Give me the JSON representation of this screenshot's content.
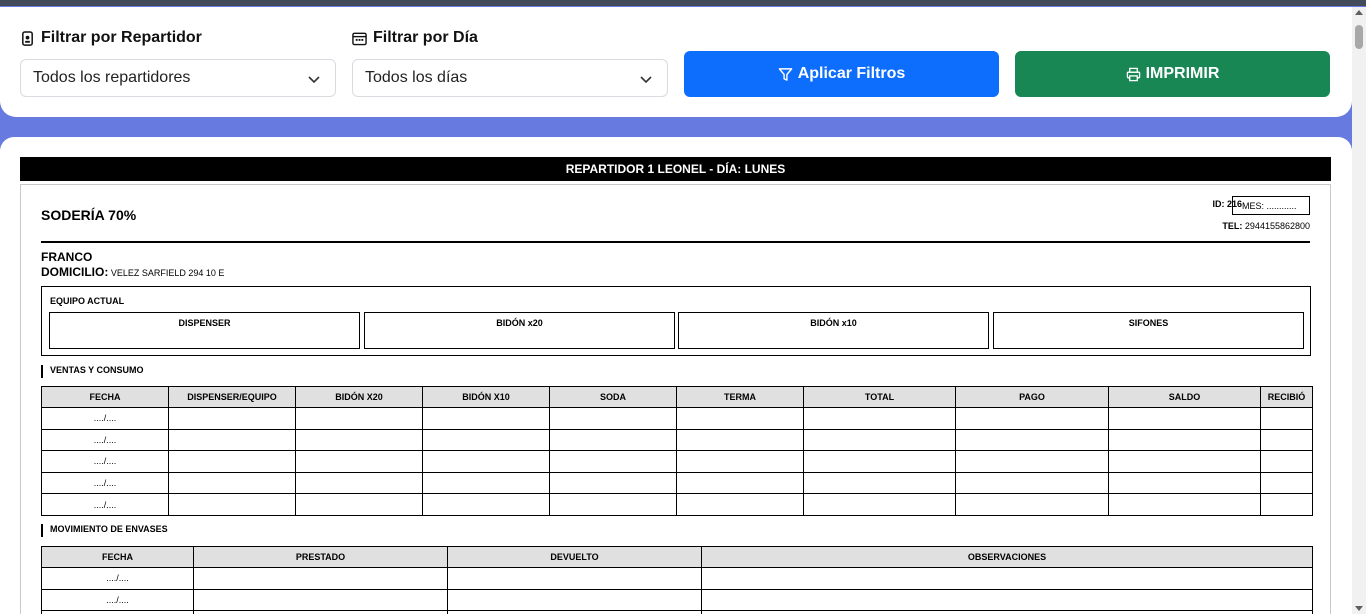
{
  "filters": {
    "repartidor": {
      "label": "Filtrar por Repartidor",
      "selected": "Todos los repartidores",
      "icon": "person-badge-icon"
    },
    "dia": {
      "label": "Filtrar por Día",
      "selected": "Todos los días",
      "icon": "calendar-icon"
    },
    "apply_label": "Aplicar Filtros",
    "print_label": "IMPRIMIR"
  },
  "colors": {
    "apply": "#0d6efd",
    "print": "#198754",
    "background": "#667ae0"
  },
  "document": {
    "header": "REPARTIDOR 1 LEONEL - DÍA: LUNES",
    "business": "SODERÍA 70%",
    "id_text": "ID: 216",
    "mes_text": "MES: ............",
    "tel_label": "TEL:",
    "tel_value": "2944155862800",
    "client_name": "FRANCO",
    "address_label": "DOMICILIO:",
    "address_value": "VELEZ SARFIELD 294 10 E",
    "equipment": {
      "title": "EQUIPO ACTUAL",
      "items": [
        "DISPENSER",
        "BIDÓN x20",
        "BIDÓN x10",
        "SIFONES"
      ]
    },
    "sales": {
      "title": "VENTAS Y CONSUMO",
      "headers": [
        "FECHA",
        "DISPENSER/EQUIPO",
        "BIDÓN X20",
        "BIDÓN X10",
        "SODA",
        "TERMA",
        "TOTAL",
        "PAGO",
        "SALDO",
        "RECIBIÓ"
      ],
      "rows": [
        "..../....",
        "..../....",
        "..../....",
        "..../....",
        "..../...."
      ]
    },
    "containers": {
      "title": "MOVIMIENTO DE ENVASES",
      "headers": [
        "FECHA",
        "PRESTADO",
        "DEVUELTO",
        "OBSERVACIONES"
      ],
      "rows": [
        "..../....",
        "..../....",
        ""
      ]
    }
  }
}
